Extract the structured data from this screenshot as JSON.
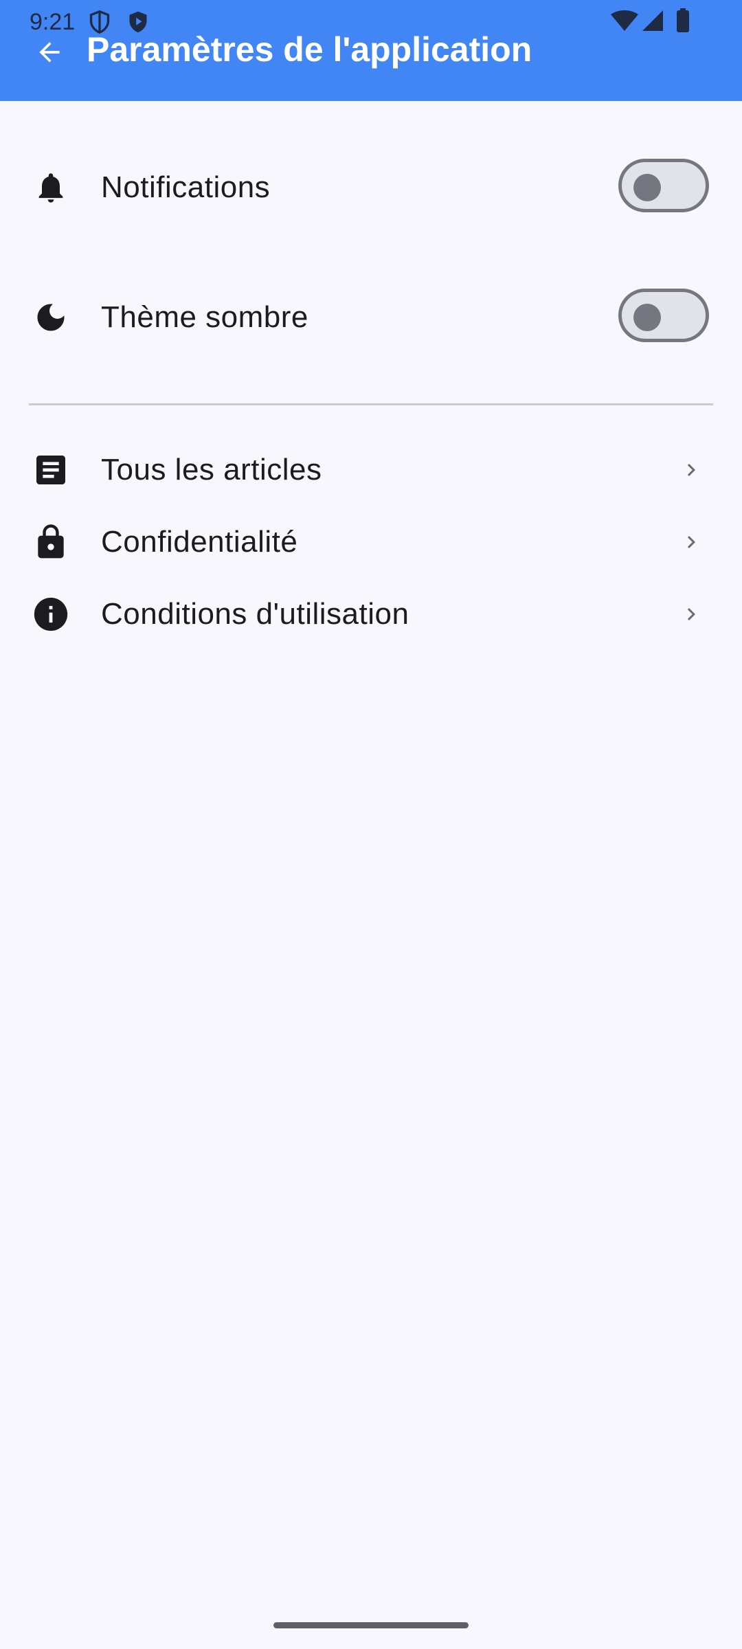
{
  "status_bar": {
    "time": "9:21",
    "left_icons": [
      "shield-outline-icon",
      "shield-play-icon"
    ],
    "right_icons": [
      "wifi-icon",
      "cell-signal-icon",
      "battery-icon"
    ]
  },
  "app_bar": {
    "title": "Paramètres de l'application",
    "back_icon": "arrow-back-icon",
    "background_color": "#4285f4"
  },
  "settings": {
    "toggles": [
      {
        "label": "Notifications",
        "icon": "bell-icon",
        "enabled": false
      },
      {
        "label": "Thème sombre",
        "icon": "moon-icon",
        "enabled": false
      }
    ],
    "links": [
      {
        "label": "Tous les articles",
        "icon": "article-icon"
      },
      {
        "label": "Confidentialité",
        "icon": "lock-icon"
      },
      {
        "label": "Conditions d'utilisation",
        "icon": "info-icon"
      }
    ]
  }
}
